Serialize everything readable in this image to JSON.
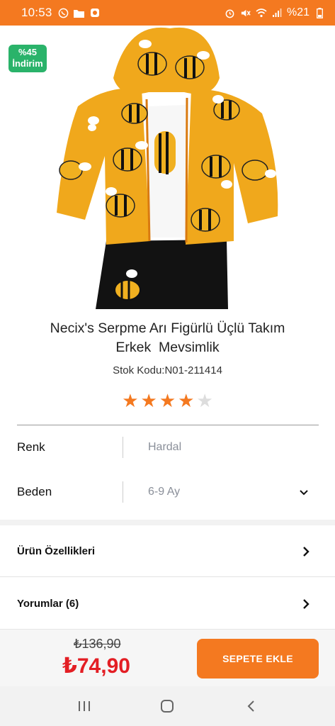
{
  "status_bar": {
    "time": "10:53",
    "battery": "%21"
  },
  "product": {
    "discount_percent": "%45",
    "discount_label": "İndirim",
    "title_line1": "Necix's Serpme Arı Figürlü Üçlü Takım",
    "title_line2": "Erkek  Mevsimlik",
    "sku": "Stok Kodu:N01-211414",
    "rating": 4,
    "rating_max": 5
  },
  "options": [
    {
      "label": "Renk",
      "value": "Hardal"
    },
    {
      "label": "Beden",
      "value": "6-9 Ay"
    }
  ],
  "sections": [
    {
      "label": "Ürün Özellikleri"
    },
    {
      "label": "Yorumlar (6)"
    }
  ],
  "pricing": {
    "old_price": "₺136,90",
    "new_price": "₺74,90"
  },
  "cart_button": {
    "label": "SEPETE EKLE"
  },
  "colors": {
    "accent": "#f47920",
    "badge": "#2ab36a",
    "price": "#e31e24"
  },
  "icons": [
    "whatsapp-icon",
    "folder-icon",
    "app-notification-icon",
    "alarm-icon",
    "mute-icon",
    "wifi-icon",
    "signal-icon",
    "battery-icon",
    "chevron-down-icon",
    "chevron-right-icon",
    "recent-apps-icon",
    "home-icon",
    "back-icon"
  ]
}
